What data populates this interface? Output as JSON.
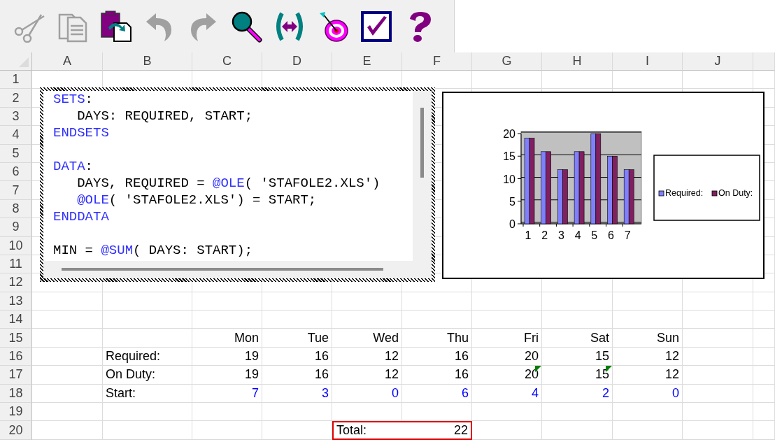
{
  "toolbar": {
    "buttons": [
      {
        "kind": "cut",
        "disabled": true
      },
      {
        "kind": "copy",
        "disabled": true
      },
      {
        "kind": "paste",
        "disabled": false
      },
      {
        "kind": "undo",
        "disabled": true
      },
      {
        "kind": "redo",
        "disabled": true
      },
      {
        "kind": "find",
        "disabled": false
      },
      {
        "kind": "match",
        "disabled": false
      },
      {
        "kind": "target",
        "disabled": false
      },
      {
        "kind": "check",
        "disabled": false
      },
      {
        "kind": "help",
        "disabled": false
      }
    ]
  },
  "sheet": {
    "columns": [
      "A",
      "B",
      "C",
      "D",
      "E",
      "F",
      "G",
      "H",
      "I",
      "J"
    ],
    "rows": [
      "1",
      "2",
      "3",
      "4",
      "5",
      "6",
      "7",
      "8",
      "9",
      "10",
      "11",
      "12",
      "13",
      "14",
      "15",
      "16",
      "17",
      "18",
      "19",
      "20"
    ]
  },
  "code_editor": {
    "lines": [
      {
        "kind": "code",
        "indented": false,
        "tokens": [
          {
            "text": "SETS",
            "kind": "keyword"
          },
          {
            "text": ":",
            "kind": "plain"
          }
        ]
      },
      {
        "kind": "code",
        "indented": true,
        "tokens": [
          {
            "text": "DAYS: REQUIRED, START;",
            "kind": "plain"
          }
        ]
      },
      {
        "kind": "code",
        "indented": false,
        "tokens": [
          {
            "text": "ENDSETS",
            "kind": "keyword"
          }
        ]
      },
      {
        "kind": "blank"
      },
      {
        "kind": "code",
        "indented": false,
        "tokens": [
          {
            "text": "DATA",
            "kind": "keyword"
          },
          {
            "text": ":",
            "kind": "plain"
          }
        ]
      },
      {
        "kind": "code",
        "indented": true,
        "tokens": [
          {
            "text": "DAYS, REQUIRED = ",
            "kind": "plain"
          },
          {
            "text": "@OLE",
            "kind": "keyword"
          },
          {
            "text": "( 'STAFOLE2.XLS')",
            "kind": "plain"
          }
        ]
      },
      {
        "kind": "code",
        "indented": true,
        "tokens": [
          {
            "text": "@OLE",
            "kind": "keyword"
          },
          {
            "text": "( 'STAFOLE2.XLS') = START;",
            "kind": "plain"
          }
        ]
      },
      {
        "kind": "code",
        "indented": false,
        "tokens": [
          {
            "text": "ENDDATA",
            "kind": "keyword"
          }
        ]
      },
      {
        "kind": "blank"
      },
      {
        "kind": "code",
        "indented": false,
        "tokens": [
          {
            "text": "MIN = ",
            "kind": "plain"
          },
          {
            "text": "@SUM",
            "kind": "keyword"
          },
          {
            "text": "( DAYS: START);",
            "kind": "plain"
          }
        ]
      }
    ]
  },
  "chart": {
    "chart_data": {
      "type": "bar",
      "categories": [
        "1",
        "2",
        "3",
        "4",
        "5",
        "6",
        "7"
      ],
      "series": [
        {
          "name": "Required:",
          "color": "#8080ff",
          "values": [
            19,
            16,
            12,
            16,
            20,
            15,
            12
          ]
        },
        {
          "name": "On Duty:",
          "color": "#802060",
          "values": [
            19,
            16,
            12,
            16,
            20,
            15,
            12
          ]
        }
      ],
      "ylim": [
        0,
        20
      ],
      "yticks": [
        0,
        5,
        10,
        15,
        20
      ],
      "legend": "right"
    }
  },
  "schedule": {
    "days": [
      "Mon",
      "Tue",
      "Wed",
      "Thu",
      "Fri",
      "Sat",
      "Sun"
    ],
    "rows": [
      {
        "label": "Required:",
        "kind": "computed",
        "values": [
          {
            "text": "19",
            "flagged": false
          },
          {
            "text": "16",
            "flagged": false
          },
          {
            "text": "12",
            "flagged": false
          },
          {
            "text": "16",
            "flagged": false
          },
          {
            "text": "20",
            "flagged": false
          },
          {
            "text": "15",
            "flagged": false
          },
          {
            "text": "12",
            "flagged": false
          }
        ]
      },
      {
        "label": "On Duty:",
        "kind": "computed",
        "values": [
          {
            "text": "19",
            "flagged": false
          },
          {
            "text": "16",
            "flagged": false
          },
          {
            "text": "12",
            "flagged": false
          },
          {
            "text": "16",
            "flagged": false
          },
          {
            "text": "20",
            "flagged": true
          },
          {
            "text": "15",
            "flagged": true
          },
          {
            "text": "12",
            "flagged": false
          }
        ]
      },
      {
        "label": "Start:",
        "kind": "input",
        "values": [
          {
            "text": "7",
            "flagged": false
          },
          {
            "text": "3",
            "flagged": false
          },
          {
            "text": "0",
            "flagged": false
          },
          {
            "text": "6",
            "flagged": false
          },
          {
            "text": "4",
            "flagged": false
          },
          {
            "text": "2",
            "flagged": false
          },
          {
            "text": "0",
            "flagged": false
          }
        ]
      }
    ],
    "total": {
      "label": "Total:",
      "value": "22"
    }
  }
}
